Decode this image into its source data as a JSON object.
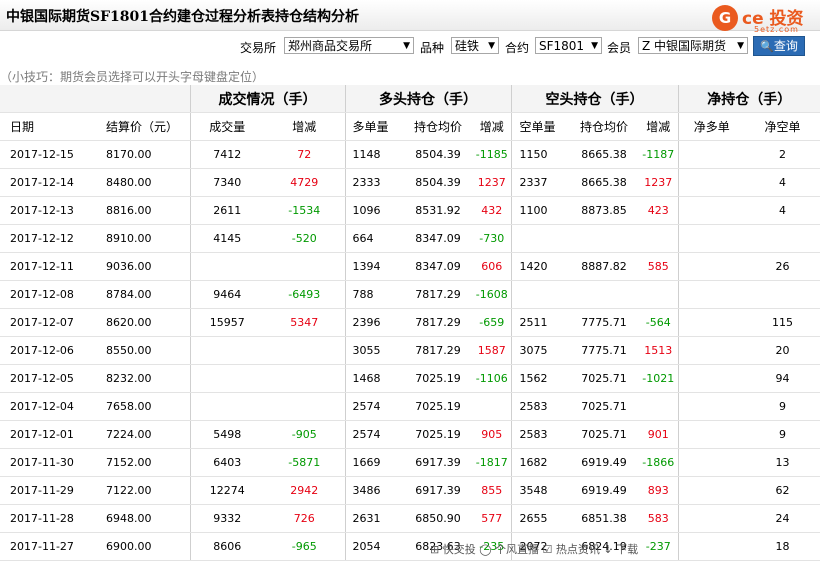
{
  "title": "中银国际期货SF1801合约建仓过程分析表持仓结构分析",
  "logo": {
    "text": "ce 投资",
    "sub": "5etz.com",
    "over": "集友"
  },
  "filters": {
    "exchange_label": "交易所",
    "exchange_value": "郑州商品交易所",
    "product_label": "品种",
    "product_value": "硅铁",
    "contract_label": "合约",
    "contract_value": "SF1801",
    "member_label": "会员",
    "member_value": "Z 中银国际期货",
    "query_label": "查询"
  },
  "tip": "（小技巧：期货会员选择可以开头字母键盘定位）",
  "groups": [
    "成交情况（手）",
    "多头持仓（手）",
    "空头持仓（手）",
    "净持仓（手）"
  ],
  "columns": [
    "日期",
    "结算价（元）",
    "成交量",
    "增减",
    "多单量",
    "持仓均价",
    "增减",
    "空单量",
    "持仓均价",
    "增减",
    "净多单",
    "净空单"
  ],
  "rows": [
    [
      "2017-12-15",
      "8170.00",
      "7412",
      "72",
      "1148",
      "8504.39",
      "-1185",
      "1150",
      "8665.38",
      "-1187",
      "",
      "2"
    ],
    [
      "2017-12-14",
      "8480.00",
      "7340",
      "4729",
      "2333",
      "8504.39",
      "1237",
      "2337",
      "8665.38",
      "1237",
      "",
      "4"
    ],
    [
      "2017-12-13",
      "8816.00",
      "2611",
      "-1534",
      "1096",
      "8531.92",
      "432",
      "1100",
      "8873.85",
      "423",
      "",
      "4"
    ],
    [
      "2017-12-12",
      "8910.00",
      "4145",
      "-520",
      "664",
      "8347.09",
      "-730",
      "",
      "",
      "",
      "",
      ""
    ],
    [
      "2017-12-11",
      "9036.00",
      "",
      "",
      "1394",
      "8347.09",
      "606",
      "1420",
      "8887.82",
      "585",
      "",
      "26"
    ],
    [
      "2017-12-08",
      "8784.00",
      "9464",
      "-6493",
      "788",
      "7817.29",
      "-1608",
      "",
      "",
      "",
      "",
      ""
    ],
    [
      "2017-12-07",
      "8620.00",
      "15957",
      "5347",
      "2396",
      "7817.29",
      "-659",
      "2511",
      "7775.71",
      "-564",
      "",
      "115"
    ],
    [
      "2017-12-06",
      "8550.00",
      "",
      "",
      "3055",
      "7817.29",
      "1587",
      "3075",
      "7775.71",
      "1513",
      "",
      "20"
    ],
    [
      "2017-12-05",
      "8232.00",
      "",
      "",
      "1468",
      "7025.19",
      "-1106",
      "1562",
      "7025.71",
      "-1021",
      "",
      "94"
    ],
    [
      "2017-12-04",
      "7658.00",
      "",
      "",
      "2574",
      "7025.19",
      "",
      "2583",
      "7025.71",
      "",
      "",
      "9"
    ],
    [
      "2017-12-01",
      "7224.00",
      "5498",
      "-905",
      "2574",
      "7025.19",
      "905",
      "2583",
      "7025.71",
      "901",
      "",
      "9"
    ],
    [
      "2017-11-30",
      "7152.00",
      "6403",
      "-5871",
      "1669",
      "6917.39",
      "-1817",
      "1682",
      "6919.49",
      "-1866",
      "",
      "13"
    ],
    [
      "2017-11-29",
      "7122.00",
      "12274",
      "2942",
      "3486",
      "6917.39",
      "855",
      "3548",
      "6919.49",
      "893",
      "",
      "62"
    ],
    [
      "2017-11-28",
      "6948.00",
      "9332",
      "726",
      "2631",
      "6850.90",
      "577",
      "2655",
      "6851.38",
      "583",
      "",
      "24"
    ],
    [
      "2017-11-27",
      "6900.00",
      "8606",
      "-965",
      "2054",
      "6823.63",
      "-235",
      "2072",
      "6824.19",
      "-237",
      "",
      "18"
    ]
  ],
  "colors": {
    "up": "#e60012",
    "down": "#009900",
    "button": "#2b6bb4",
    "brand": "#ea5a1f"
  },
  "bottom_bar": "⊞ 快交投    ◯ 个风直播    ☑ 热点资讯     ↓ 下载"
}
